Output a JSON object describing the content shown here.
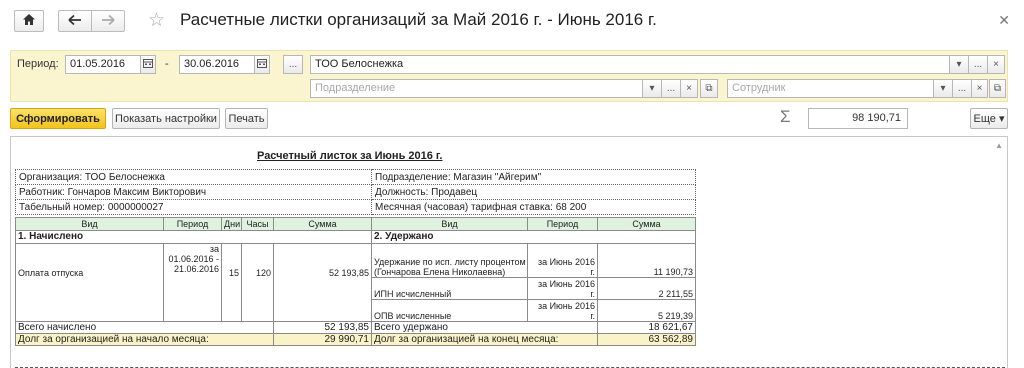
{
  "window": {
    "title": "Расчетные листки организаций  за Май 2016 г. - Июнь 2016 г."
  },
  "filters": {
    "period_label": "Период:",
    "date_from": "01.05.2016",
    "date_separator": "-",
    "date_to": "30.06.2016",
    "period_choose_label": "...",
    "organization": "ТОО Белоснежка",
    "department_placeholder": "Подразделение",
    "employee_placeholder": "Сотрудник",
    "dropdown_glyph": "▾",
    "more_glyph": "...",
    "clear_glyph": "×",
    "open_glyph": "⧉"
  },
  "toolbar": {
    "generate_label": "Сформировать",
    "settings_label": "Показать настройки",
    "print_label": "Печать",
    "sum_value": "98 190,71",
    "more_label": "Еще ▾"
  },
  "report": {
    "title": "Расчетный листок за Июнь 2016 г.",
    "organization": "Организация: ТОО Белоснежка",
    "department": "Подразделение: Магазин \"Айгерим\"",
    "employee": "Работник: Гончаров Максим Викторович",
    "position": "Должность: Продавец",
    "tab_number": "Табельный номер: 0000000027",
    "tariff": "Месячная (часовая) тарифная ставка: 68 200",
    "columns_left": [
      "Вид",
      "Период",
      "Дни",
      "Часы",
      "Сумма"
    ],
    "columns_right": [
      "Вид",
      "Период",
      "Сумма"
    ],
    "accrued_title": "1. Начислено",
    "withheld_title": "2. Удержано",
    "accrual": {
      "name": "Оплата отпуска",
      "period_line1": "за",
      "period_line2": "01.06.2016 -",
      "period_line3": "21.06.2016",
      "days": "15",
      "hours": "120",
      "amount": "52 193,85"
    },
    "deductions": [
      {
        "name_line1": "Удержание по исп. листу процентом",
        "name_line2": "(Гончарова Елена Николаевна)",
        "period_line1": "за Июнь 2016",
        "period_line2": "г.",
        "amount": "11 190,73"
      },
      {
        "name_line1": "",
        "name_line2": "ИПН исчисленный",
        "period_line1": "за Июнь 2016",
        "period_line2": "г.",
        "amount": "2 211,55"
      },
      {
        "name_line1": "",
        "name_line2": "ОПВ исчисленные",
        "period_line1": "за Июнь 2016",
        "period_line2": "г.",
        "amount": "5 219,39"
      }
    ],
    "total_accrued_label": "Всего начислено",
    "total_accrued": "52 193,85",
    "total_withheld_label": "Всего удержано",
    "total_withheld": "18 621,67",
    "debt_start_label": "Долг за организацией на начало месяца:",
    "debt_start": "29 990,71",
    "debt_end_label": "Долг за организацией на конец месяца:",
    "debt_end": "63 562,89"
  }
}
